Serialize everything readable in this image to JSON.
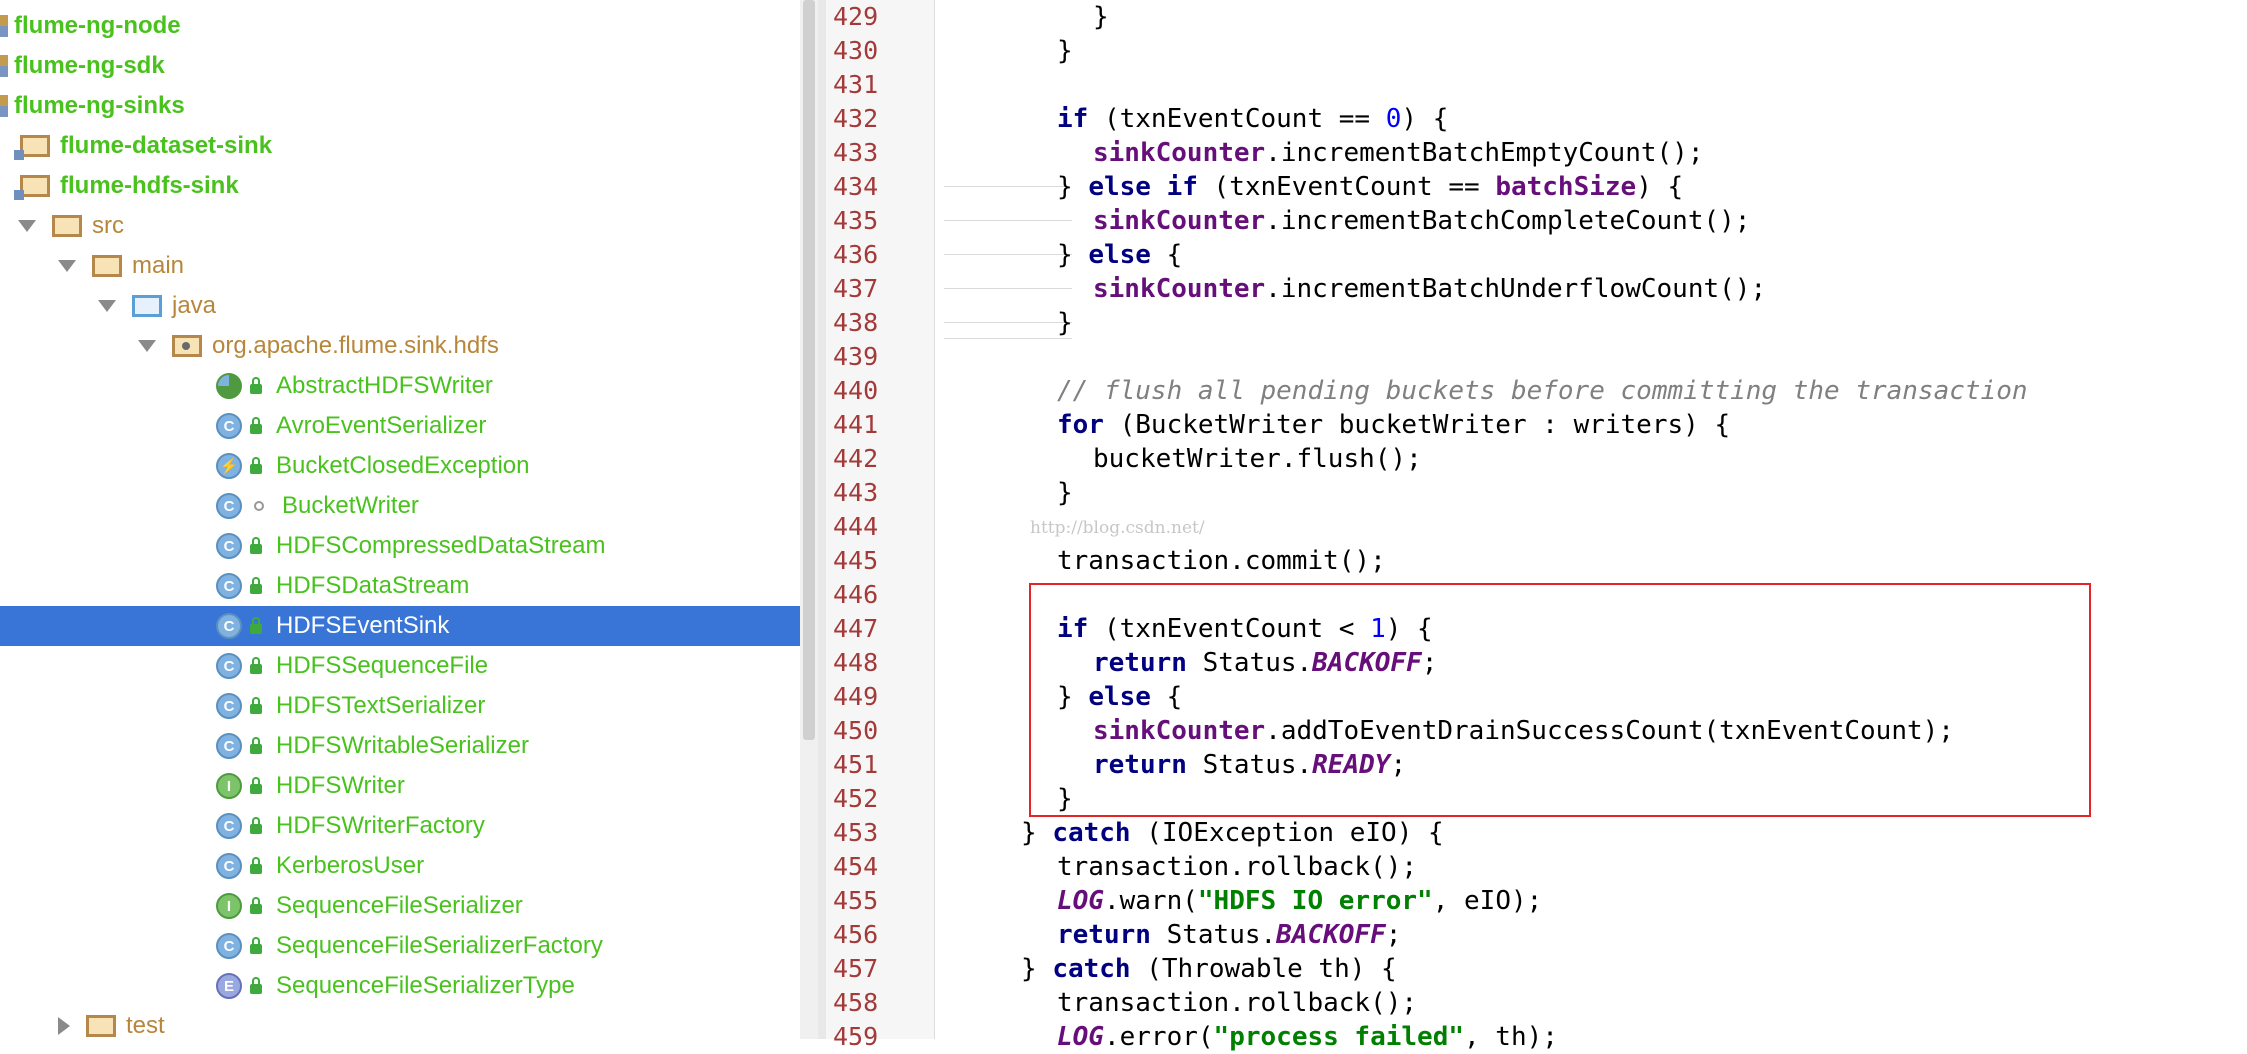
{
  "project_tree": {
    "items": [
      {
        "label": "flume-ng-node",
        "kind": "module"
      },
      {
        "label": "flume-ng-sdk",
        "kind": "module"
      },
      {
        "label": "flume-ng-sinks",
        "kind": "module"
      },
      {
        "label": "flume-dataset-sink",
        "kind": "module-folder"
      },
      {
        "label": "flume-hdfs-sink",
        "kind": "module-folder"
      },
      {
        "label": "src",
        "kind": "folder",
        "expanded": true
      },
      {
        "label": "main",
        "kind": "folder",
        "expanded": true
      },
      {
        "label": "java",
        "kind": "source-folder",
        "expanded": true
      },
      {
        "label": "org.apache.flume.sink.hdfs",
        "kind": "package",
        "expanded": true
      },
      {
        "label": "AbstractHDFSWriter",
        "icon": "abstract-class-icon"
      },
      {
        "label": "AvroEventSerializer",
        "icon": "class-icon"
      },
      {
        "label": "BucketClosedException",
        "icon": "exception-class-icon"
      },
      {
        "label": "BucketWriter",
        "icon": "class-icon"
      },
      {
        "label": "HDFSCompressedDataStream",
        "icon": "class-icon"
      },
      {
        "label": "HDFSDataStream",
        "icon": "class-icon"
      },
      {
        "label": "HDFSEventSink",
        "icon": "class-icon",
        "selected": true
      },
      {
        "label": "HDFSSequenceFile",
        "icon": "class-icon"
      },
      {
        "label": "HDFSTextSerializer",
        "icon": "class-icon"
      },
      {
        "label": "HDFSWritableSerializer",
        "icon": "class-icon"
      },
      {
        "label": "HDFSWriter",
        "icon": "interface-icon"
      },
      {
        "label": "HDFSWriterFactory",
        "icon": "class-icon"
      },
      {
        "label": "KerberosUser",
        "icon": "class-icon"
      },
      {
        "label": "SequenceFileSerializer",
        "icon": "interface-icon"
      },
      {
        "label": "SequenceFileSerializerFactory",
        "icon": "class-icon"
      },
      {
        "label": "SequenceFileSerializerType",
        "icon": "enum-icon"
      },
      {
        "label": "test",
        "kind": "folder",
        "expanded": false
      }
    ],
    "icon_letters": {
      "class": "C",
      "interface": "I",
      "enum": "E",
      "exception": "⚡"
    }
  },
  "editor": {
    "line_numbers": [
      "429",
      "430",
      "431",
      "432",
      "433",
      "434",
      "435",
      "436",
      "437",
      "438",
      "439",
      "440",
      "441",
      "442",
      "443",
      "444",
      "445",
      "446",
      "447",
      "448",
      "449",
      "450",
      "451",
      "452",
      "453",
      "454",
      "455",
      "456",
      "457",
      "458",
      "459"
    ],
    "code": {
      "l429": "}",
      "l430": "}",
      "l432": {
        "kw": "if",
        "a": " (txnEventCount == ",
        "num": "0",
        "b": ") {"
      },
      "l433": {
        "fld": "sinkCounter",
        "a": ".incrementBatchEmptyCount();"
      },
      "l434": {
        "a": "} ",
        "kw": "else if",
        "b": " (txnEventCount == ",
        "fld": "batchSize",
        "c": ") {"
      },
      "l435": {
        "fld": "sinkCounter",
        "a": ".incrementBatchCompleteCount();"
      },
      "l436": {
        "a": "} ",
        "kw": "else",
        "b": " {"
      },
      "l437": {
        "fld": "sinkCounter",
        "a": ".incrementBatchUnderflowCount();"
      },
      "l438": "}",
      "l440": "// flush all pending buckets before committing the transaction",
      "l441": {
        "kw": "for",
        "a": " (BucketWriter bucketWriter : writers) {"
      },
      "l442": "bucketWriter.flush();",
      "l443": "}",
      "l445": "transaction.commit();",
      "l447": {
        "kw": "if",
        "a": " (txnEventCount < ",
        "num": "1",
        "b": ") {"
      },
      "l448": {
        "kw": "return",
        "a": " Status.",
        "cst": "BACKOFF",
        "b": ";"
      },
      "l449": {
        "a": "} ",
        "kw": "else",
        "b": " {"
      },
      "l450": {
        "fld": "sinkCounter",
        "a": ".addToEventDrainSuccessCount(txnEventCount);"
      },
      "l451": {
        "kw": "return",
        "a": " Status.",
        "cst": "READY",
        "b": ";"
      },
      "l452": "}",
      "l453": {
        "a": "} ",
        "kw": "catch",
        "b": " (IOException eIO) {"
      },
      "l454": "transaction.rollback();",
      "l455": {
        "cst": "LOG",
        "a": ".warn(",
        "str": "\"HDFS IO error\"",
        "b": ", eIO);"
      },
      "l456": {
        "kw": "return",
        "a": " Status.",
        "cst": "BACKOFF",
        "b": ";"
      },
      "l457": {
        "a": "} ",
        "kw": "catch",
        "b": " (Throwable th) {"
      },
      "l458": "transaction.rollback();",
      "l459": {
        "cst": "LOG",
        "a": ".error(",
        "str": "\"process failed\"",
        "b": ", th);"
      }
    },
    "watermark": "http://blog.csdn.net/"
  },
  "colors": {
    "selection": "#3875d7",
    "tree_text": "#49c21e",
    "keyword": "#000080",
    "field": "#660e7a",
    "number": "#0000ff",
    "comment": "#808080",
    "string": "#008000",
    "line_number": "#a33a3a",
    "highlight_box": "#e32525"
  }
}
